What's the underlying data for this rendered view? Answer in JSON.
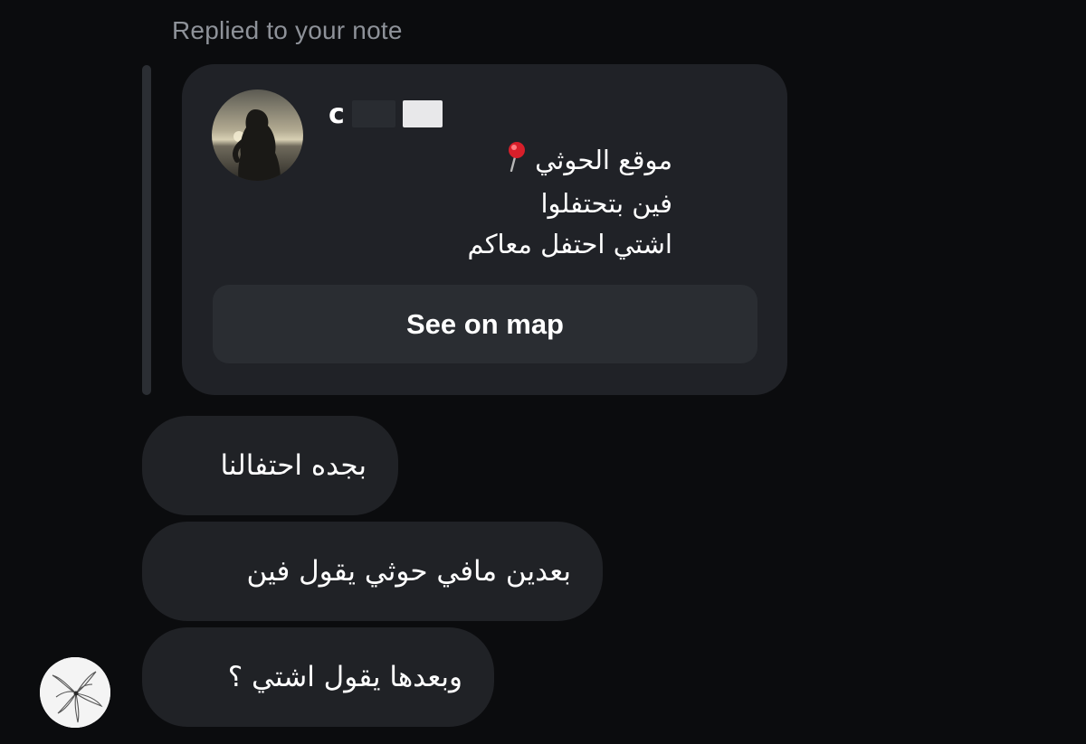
{
  "reply_context": "Replied to your note",
  "note": {
    "author_initial": "c",
    "lines": [
      "موقع الحوثي",
      "فين بتحتفلوا",
      "اشتي احتفل معاكم"
    ],
    "pin_icon": "round-pushpin-icon",
    "map_button_label": "See on map"
  },
  "messages": [
    "بجده احتفالنا",
    "بعدين مافي حوثي يقول فين",
    "وبعدها يقول اشتي ؟"
  ],
  "colors": {
    "background": "#0b0c0e",
    "bubble": "#202226",
    "card": "#202227",
    "button": "#2a2d32",
    "muted_text": "#8e9299",
    "pin_red": "#e0202a"
  }
}
